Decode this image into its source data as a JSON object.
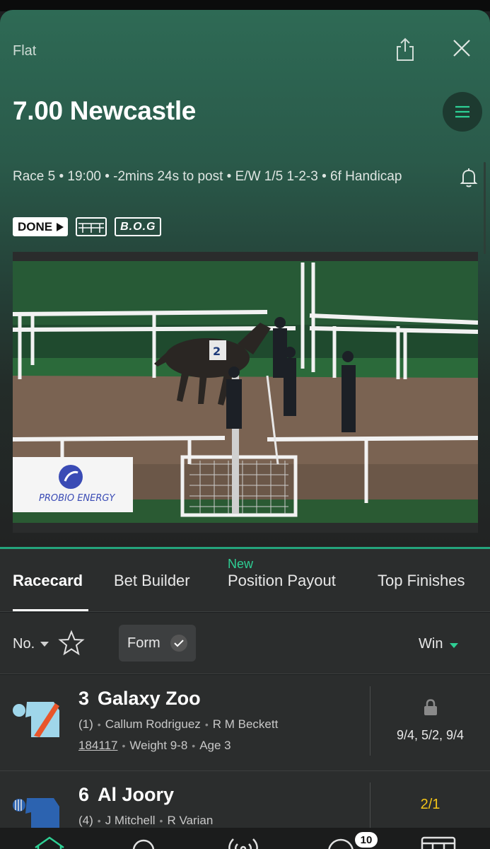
{
  "race": {
    "category": "Flat",
    "title": "7.00 Newcastle",
    "info": "Race 5 • 19:00 • -2mins 24s to post • E/W 1/5 1-2-3 • 6f Handicap",
    "badges": {
      "done": "DONE",
      "bog": "B.O.G"
    }
  },
  "video": {
    "sponsor_text": "PROBIO ENERGY",
    "saddle_number": "2"
  },
  "tabs": [
    {
      "label": "Racecard",
      "active": true
    },
    {
      "label": "Bet Builder"
    },
    {
      "label": "Position Payout",
      "tag": "New"
    },
    {
      "label": "Top Finishes"
    }
  ],
  "filters": {
    "sort_label": "No.",
    "form_label": "Form",
    "market_label": "Win"
  },
  "runners": [
    {
      "number": "3",
      "name": "Galaxy Zoo",
      "draw": "(1)",
      "jockey": "Callum Rodriguez",
      "trainer": "R M Beckett",
      "form": "184117",
      "weight": "Weight 9-8",
      "age": "Age 3",
      "odds": "9/4, 5/2, 9/4",
      "locked": true
    },
    {
      "number": "6",
      "name": "Al Joory",
      "draw": "(4)",
      "jockey": "J Mitchell",
      "trainer": "R Varian",
      "odds": "2/1",
      "locked": false
    }
  ],
  "bottom_nav": {
    "bets_count": "10"
  },
  "colors": {
    "accent": "#2ecf94",
    "live_odds": "#f5c518",
    "header_top": "#2e6a55"
  }
}
